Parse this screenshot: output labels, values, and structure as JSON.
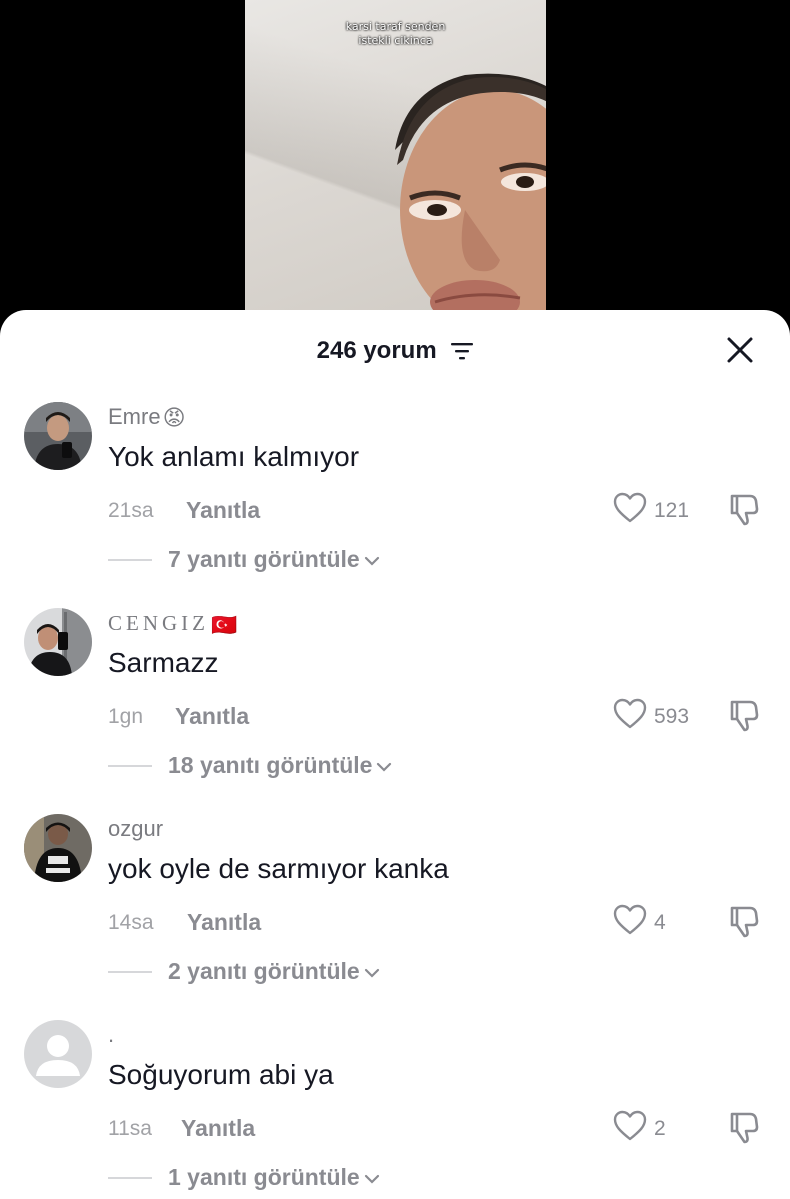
{
  "video": {
    "caption_line1": "karsi taraf senden",
    "caption_line2": "istekli cikinca"
  },
  "header": {
    "title": "246 yorum",
    "filter_icon": "filter-icon",
    "close_icon": "close-icon"
  },
  "labels": {
    "reply": "Yanıtla"
  },
  "comments": [
    {
      "username": "Emre",
      "badge": "😡",
      "text": "Yok anlamı kalmıyor",
      "time": "21sa",
      "likes": "121",
      "view_replies": "7 yanıtı görüntüle"
    },
    {
      "username": "CENGIZ",
      "badge": "🇹🇷",
      "text": "Sarmazz",
      "time": "1gn",
      "likes": "593",
      "view_replies": "18 yanıtı görüntüle"
    },
    {
      "username": "ozgur",
      "text": "yok oyle de sarmıyor kanka",
      "time": "14sa",
      "likes": "4",
      "view_replies": "2 yanıtı görüntüle"
    },
    {
      "username": ".",
      "text": "Soğuyorum abi ya",
      "time": "11sa",
      "likes": "2",
      "view_replies": "1 yanıtı görüntüle"
    }
  ],
  "colors": {
    "primary_text": "#161823",
    "secondary_text": "#8a8b91",
    "sheet_bg": "#ffffff",
    "video_bg": "#000000"
  }
}
